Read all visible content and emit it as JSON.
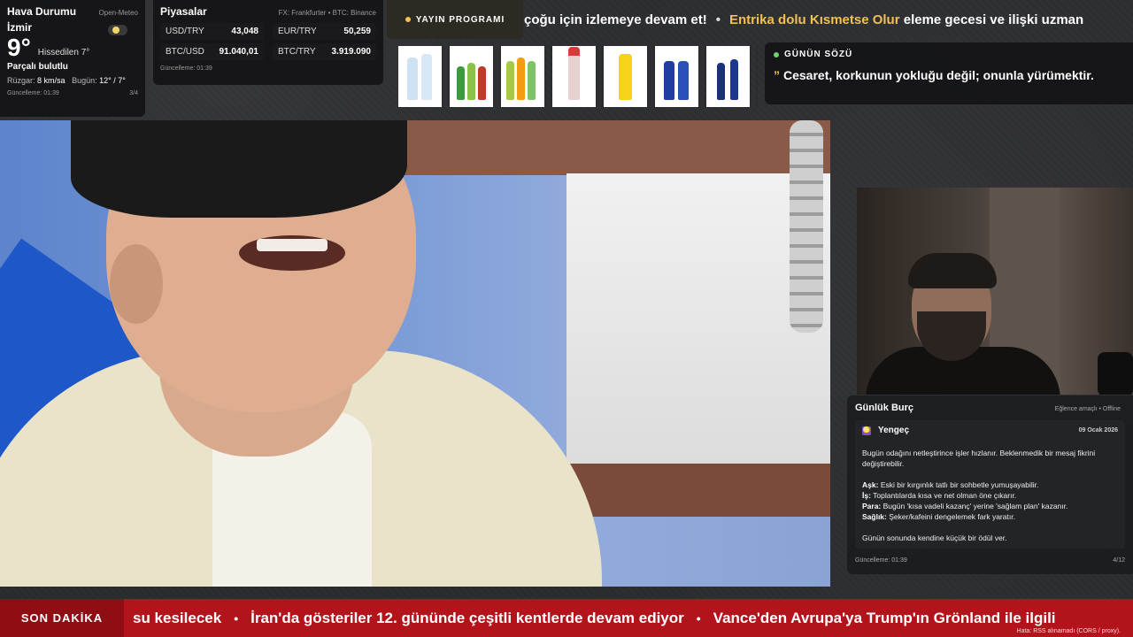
{
  "weather": {
    "title": "Hava Durumu",
    "source": "Open-Meteo",
    "city": "İzmir",
    "temp": "9°",
    "feels_like": "Hissedilen 7°",
    "condition": "Parçalı bulutlu",
    "wind_label": "Rüzgar:",
    "wind_value": "8 km/sa",
    "today_label": "Bugün:",
    "today_value": "12° / 7°",
    "updated": "Güncelleme: 01:39",
    "page": "3/4",
    "icon": "partly-cloudy-icon"
  },
  "markets": {
    "title": "Piyasalar",
    "source": "FX: Frankfurter • BTC: Binance",
    "rows": [
      {
        "symbol": "USD/TRY",
        "value": "43,048"
      },
      {
        "symbol": "EUR/TRY",
        "value": "50,259"
      },
      {
        "symbol": "BTC/USD",
        "value": "91.040,01"
      },
      {
        "symbol": "BTC/TRY",
        "value": "3.919.090"
      }
    ],
    "updated": "Güncelleme: 01:39"
  },
  "schedule": {
    "label": "YAYIN PROGRAMI"
  },
  "top_ticker": {
    "item1": "çoğu için izlemeye devam et!",
    "item2_highlight": "Entrika dolu Kısmetse Olur",
    "item2_rest": "eleme gecesi ve ilişki uzman"
  },
  "quote": {
    "title": "GÜNÜN SÖZÜ",
    "text": "Cesaret, korkunun yokluğu değil; onunla yürümektir."
  },
  "horoscope": {
    "title": "Günlük Burç",
    "source": "Eğlence amaçlı • Offline",
    "sign": "Yengeç",
    "date": "09 Ocak 2026",
    "summary": "Bugün odağını netleştirince işler hızlanır. Beklenmedik bir mesaj fikrini değiştirebilir.",
    "love_label": "Aşk:",
    "love": "Eski bir kırgınlık tatlı bir sohbetle yumuşayabilir.",
    "work_label": "İş:",
    "work": "Toplantılarda kısa ve net olman öne çıkarır.",
    "money_label": "Para:",
    "money": "Bugün 'kısa vadeli kazanç' yerine 'sağlam plan' kazanır.",
    "health_label": "Sağlık:",
    "health": "Şeker/kafeini dengelemek fark yaratır.",
    "closing": "Günün sonunda kendine küçük bir ödül ver.",
    "updated": "Güncelleme: 01:39",
    "page": "4/12"
  },
  "breaking": {
    "label": "SON DAKİKA",
    "items": [
      "su kesilecek",
      "İran'da gösteriler 12. gününde çeşitli kentlerde devam ediyor",
      "Vance'den Avrupa'ya Trump'ın Grönland ile ilgili"
    ],
    "error": "Hata: RSS alınamadı (CORS / proxy)."
  }
}
